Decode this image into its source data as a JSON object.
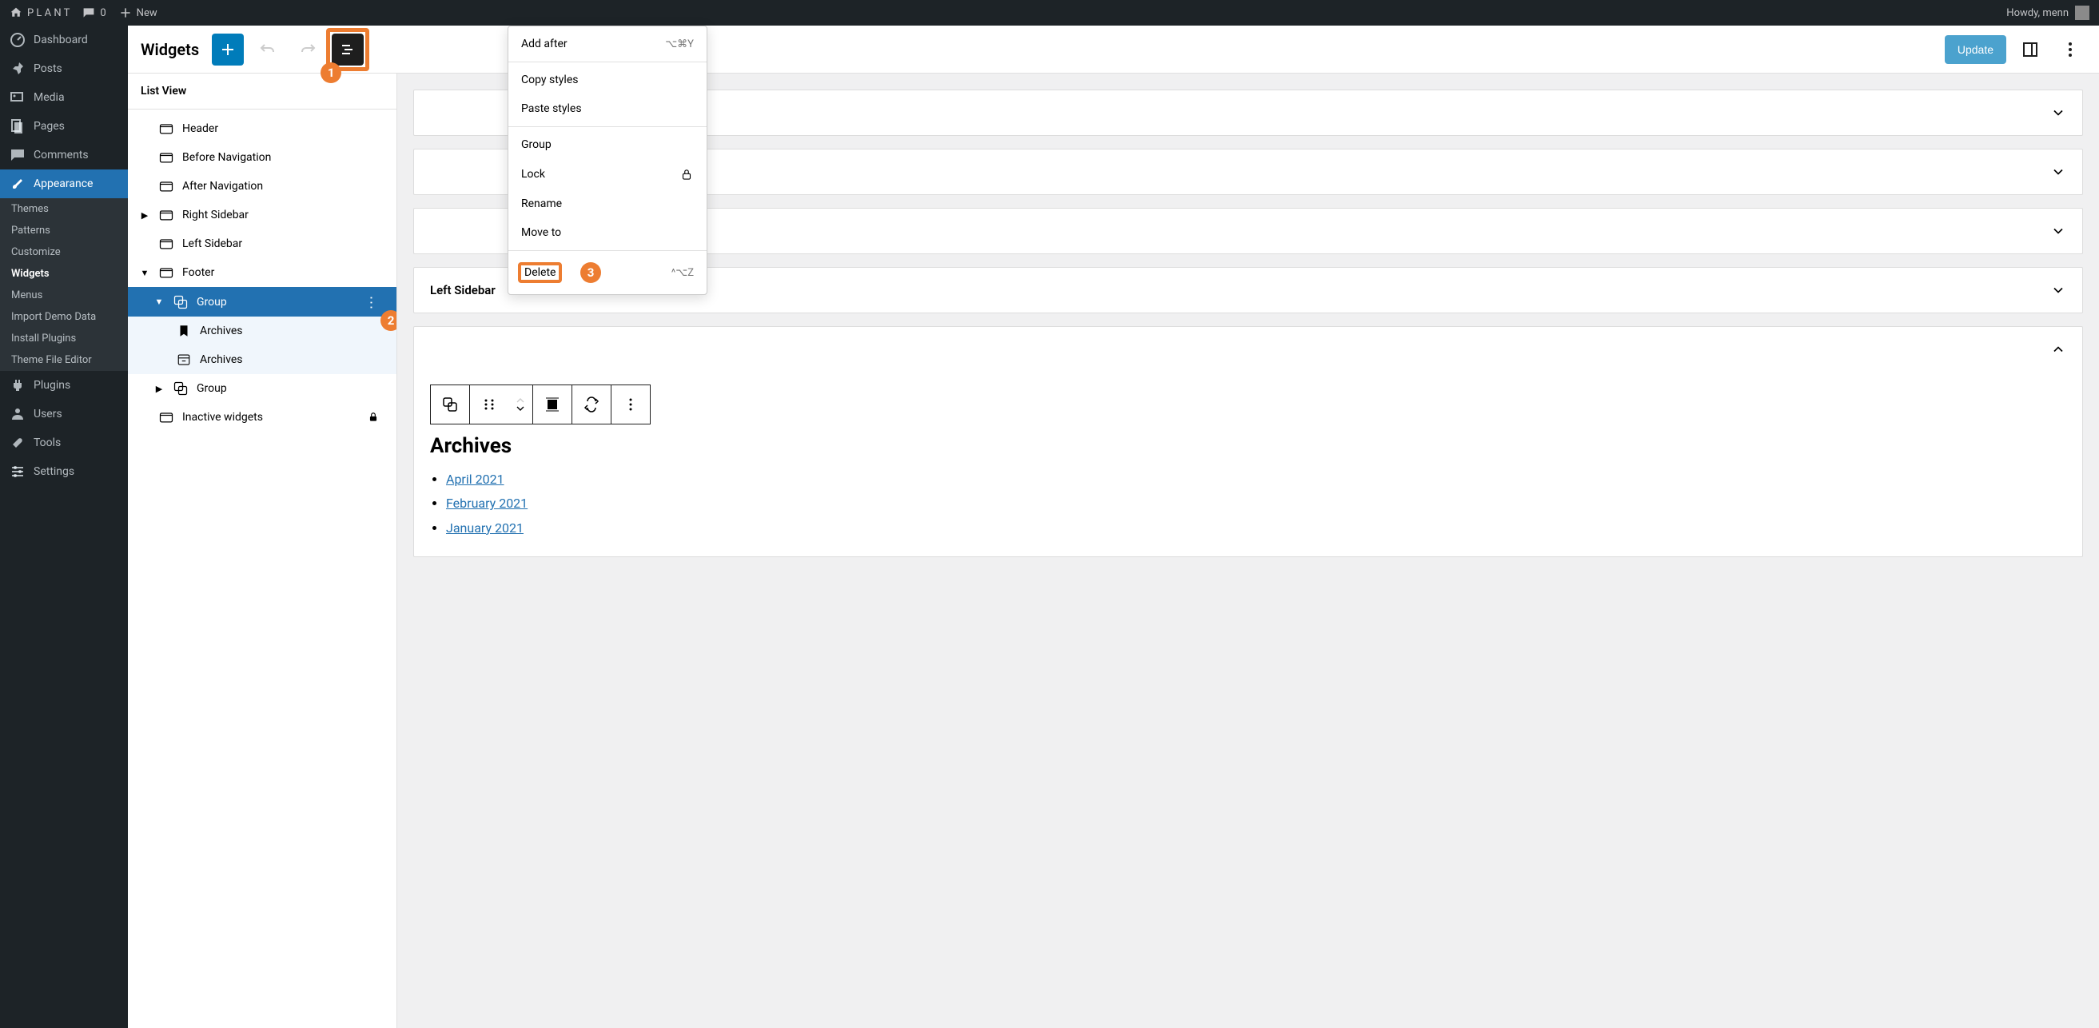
{
  "adminbar": {
    "site_name": "P L A N T",
    "comments_count": "0",
    "new_label": "New",
    "howdy": "Howdy, menn"
  },
  "sidebar": {
    "items": [
      {
        "label": "Dashboard"
      },
      {
        "label": "Posts"
      },
      {
        "label": "Media"
      },
      {
        "label": "Pages"
      },
      {
        "label": "Comments"
      },
      {
        "label": "Appearance"
      },
      {
        "label": "Plugins"
      },
      {
        "label": "Users"
      },
      {
        "label": "Tools"
      },
      {
        "label": "Settings"
      }
    ],
    "appearance_sub": [
      {
        "label": "Themes"
      },
      {
        "label": "Patterns"
      },
      {
        "label": "Customize"
      },
      {
        "label": "Widgets"
      },
      {
        "label": "Menus"
      },
      {
        "label": "Import Demo Data"
      },
      {
        "label": "Install Plugins"
      },
      {
        "label": "Theme File Editor"
      }
    ]
  },
  "editor": {
    "title": "Widgets",
    "update": "Update"
  },
  "listview": {
    "header": "List View",
    "tree": {
      "header": "Header",
      "before_nav": "Before Navigation",
      "after_nav": "After Navigation",
      "right_sidebar": "Right Sidebar",
      "left_sidebar": "Left Sidebar",
      "footer": "Footer",
      "group1": "Group",
      "archives1": "Archives",
      "archives2": "Archives",
      "group2": "Group",
      "inactive": "Inactive widgets"
    }
  },
  "canvas": {
    "left_sidebar": "Left Sidebar",
    "archives_heading": "Archives",
    "archives": [
      "April 2021",
      "February 2021",
      "January 2021"
    ]
  },
  "context_menu": {
    "add_after": "Add after",
    "add_after_shortcut": "⌥⌘Y",
    "copy_styles": "Copy styles",
    "paste_styles": "Paste styles",
    "group": "Group",
    "lock": "Lock",
    "rename": "Rename",
    "move_to": "Move to",
    "delete": "Delete",
    "delete_shortcut": "^⌥Z"
  },
  "annotations": {
    "b1": "1",
    "b2": "2",
    "b3": "3"
  }
}
